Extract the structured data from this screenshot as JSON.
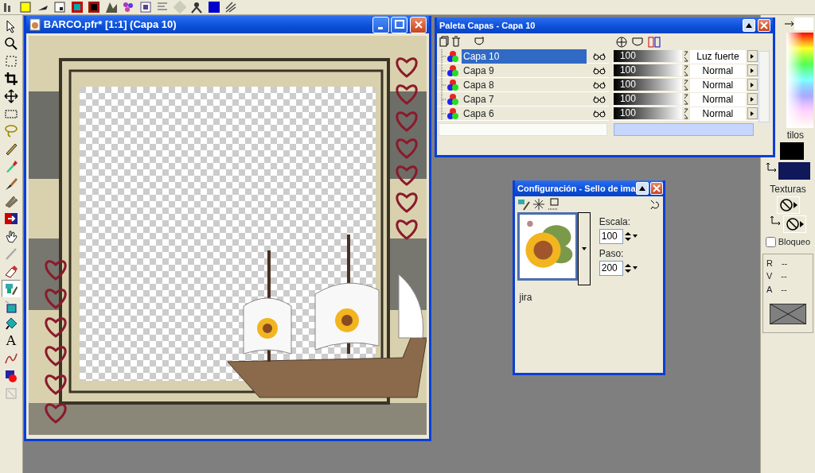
{
  "tools": [
    {
      "kind": "pointer",
      "selected": false
    },
    {
      "kind": "zoom",
      "selected": false
    },
    {
      "kind": "selection",
      "selected": false
    },
    {
      "kind": "crop",
      "selected": false
    },
    {
      "kind": "move",
      "selected": false
    },
    {
      "kind": "marquee",
      "selected": false
    },
    {
      "kind": "lasso",
      "selected": false
    },
    {
      "kind": "pencil",
      "selected": false
    },
    {
      "kind": "dropper",
      "selected": false
    },
    {
      "kind": "brush",
      "selected": false
    },
    {
      "kind": "clone",
      "selected": false
    },
    {
      "kind": "replacer",
      "selected": false
    },
    {
      "kind": "hand",
      "selected": false
    },
    {
      "kind": "scratch",
      "selected": false
    },
    {
      "kind": "eraser",
      "selected": false
    },
    {
      "kind": "stamp",
      "selected": true
    },
    {
      "kind": "bucket",
      "selected": false
    },
    {
      "kind": "pen",
      "selected": false
    },
    {
      "kind": "text",
      "glyph": "A",
      "selected": false
    },
    {
      "kind": "draw",
      "selected": false
    },
    {
      "kind": "shape",
      "selected": false
    },
    {
      "kind": "warp",
      "selected": false
    }
  ],
  "image_window": {
    "title": "BARCO.pfr* [1:1] (Capa 10)"
  },
  "layers_palette": {
    "title": "Paleta Capas - Capa 10",
    "layers": [
      {
        "name": "Capa 10",
        "selected": true,
        "opacity": "100",
        "level": 1,
        "blend_mode": "Luz fuerte"
      },
      {
        "name": "Capa 9",
        "selected": false,
        "opacity": "100",
        "level": 1,
        "blend_mode": "Normal"
      },
      {
        "name": "Capa 8",
        "selected": false,
        "opacity": "100",
        "level": 1,
        "blend_mode": "Normal"
      },
      {
        "name": "Capa 7",
        "selected": false,
        "opacity": "100",
        "level": 1,
        "blend_mode": "Normal"
      },
      {
        "name": "Capa 6",
        "selected": false,
        "opacity": "100",
        "level": 1,
        "blend_mode": "Normal"
      }
    ]
  },
  "stamp_config": {
    "title": "Configuración - Sello de ima",
    "scale_label": "Escala:",
    "scale": "100",
    "step_label": "Paso:",
    "step": "200",
    "stamp_name": "jira"
  },
  "materials": {
    "styles_label": "tilos",
    "textures_label": "Texturas",
    "lock": {
      "label": "Bloqueo",
      "checked": false
    },
    "readout": [
      {
        "label": "R",
        "value": "--"
      },
      {
        "label": "V",
        "value": "--"
      },
      {
        "label": "A",
        "value": "--"
      }
    ]
  }
}
